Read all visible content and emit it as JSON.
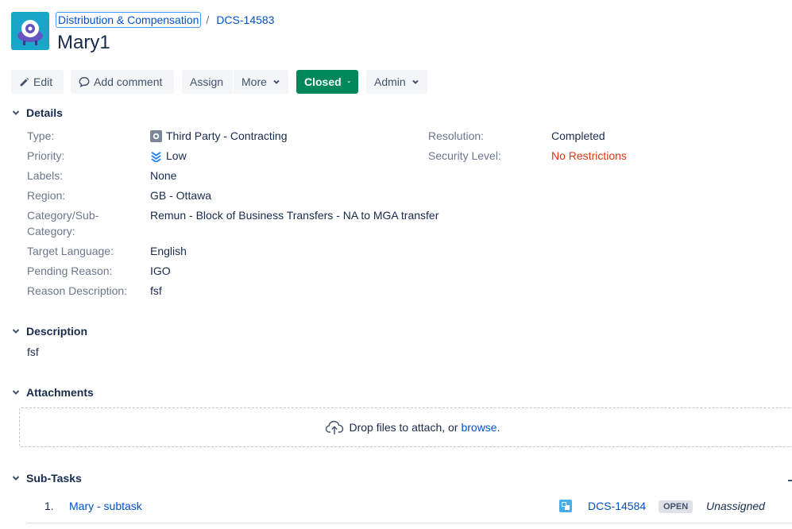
{
  "breadcrumb": {
    "project": "Distribution & Compensation",
    "separator": "/",
    "issue_key": "DCS-14583"
  },
  "title": "Mary1",
  "toolbar": {
    "edit": "Edit",
    "add_comment": "Add comment",
    "assign": "Assign",
    "more": "More",
    "status": "Closed",
    "admin": "Admin"
  },
  "details": {
    "heading": "Details",
    "left": [
      {
        "label": "Type:",
        "value": "Third Party - Contracting",
        "icon": "issue-type-icon"
      },
      {
        "label": "Priority:",
        "value": "Low",
        "icon": "priority-low-icon"
      },
      {
        "label": "Labels:",
        "value": "None"
      },
      {
        "label": "Region:",
        "value": "GB - Ottawa"
      },
      {
        "label_line1": "Category/Sub-",
        "label_line2": "Category:",
        "value": "Remun - Block of Business Transfers - NA to MGA transfer"
      },
      {
        "label": "Target Language:",
        "value": "English"
      },
      {
        "label": "Pending Reason:",
        "value": "IGO"
      },
      {
        "label": "Reason Description:",
        "value": "fsf"
      }
    ],
    "right": [
      {
        "label": "Resolution:",
        "value": "Completed"
      },
      {
        "label": "Security Level:",
        "value": "No Restrictions",
        "color": "#de350b"
      }
    ]
  },
  "description": {
    "heading": "Description",
    "text": "fsf"
  },
  "attachments": {
    "heading": "Attachments",
    "drop_text": "Drop files to attach, or",
    "browse": "browse",
    "suffix": "."
  },
  "subtasks": {
    "heading": "Sub-Tasks",
    "items": [
      {
        "number": "1.",
        "summary": "Mary - subtask",
        "key": "DCS-14584",
        "status": "OPEN",
        "assignee": "Unassigned"
      }
    ]
  },
  "colors": {
    "link": "#0052cc",
    "closed_button": "#00875a",
    "avatar": "#1aa6c9",
    "restriction_text": "#de350b"
  }
}
